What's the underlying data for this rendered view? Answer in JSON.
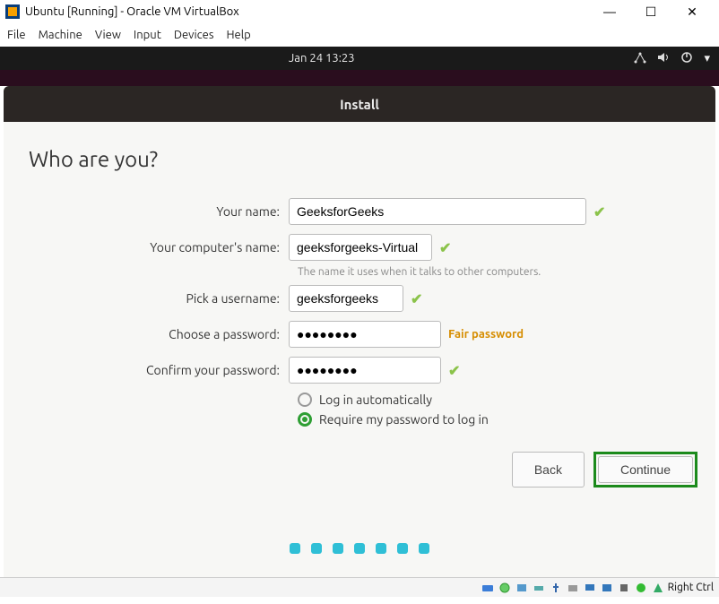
{
  "window": {
    "title": "Ubuntu [Running] - Oracle VM VirtualBox"
  },
  "menubar": {
    "file": "File",
    "machine": "Machine",
    "view": "View",
    "input": "Input",
    "devices": "Devices",
    "help": "Help"
  },
  "topbar": {
    "clock": "Jan 24   13:23"
  },
  "installer": {
    "title": "Install",
    "heading": "Who are you?",
    "labels": {
      "name": "Your name:",
      "computer": "Your computer's name:",
      "username": "Pick a username:",
      "password": "Choose a password:",
      "confirm": "Confirm your password:"
    },
    "values": {
      "name": "GeeksforGeeks",
      "computer": "geeksforgeeks-Virtual",
      "username": "geeksforgeeks",
      "password": "●●●●●●●●",
      "confirm": "●●●●●●●●"
    },
    "computer_hint": "The name it uses when it talks to other computers.",
    "password_strength": "Fair password",
    "radio": {
      "auto": "Log in automatically",
      "require": "Require my password to log in",
      "selected": "require"
    },
    "buttons": {
      "back": "Back",
      "continue": "Continue"
    }
  },
  "statusbar": {
    "host_key": "Right Ctrl"
  }
}
